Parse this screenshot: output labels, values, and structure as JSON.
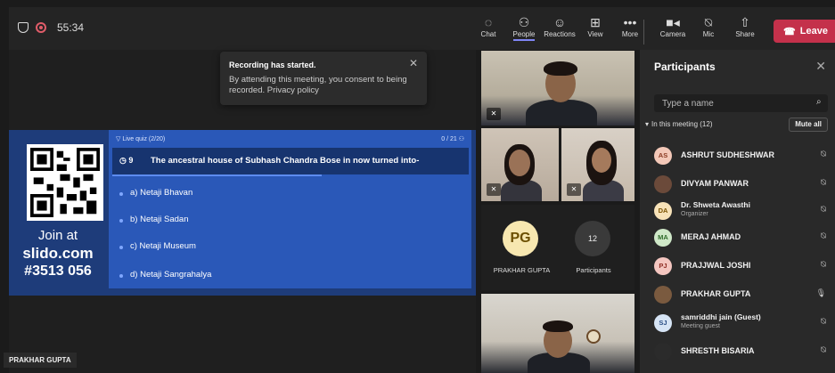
{
  "topbar": {
    "timer": "55:34",
    "tools": [
      {
        "label": "Chat",
        "icon": "chat-icon"
      },
      {
        "label": "People",
        "icon": "people-icon"
      },
      {
        "label": "Reactions",
        "icon": "reactions-icon"
      },
      {
        "label": "View",
        "icon": "view-icon"
      },
      {
        "label": "More",
        "icon": "more-icon"
      },
      {
        "label": "Camera",
        "icon": "camera-icon"
      },
      {
        "label": "Mic",
        "icon": "mic-off-icon"
      },
      {
        "label": "Share",
        "icon": "share-icon"
      }
    ],
    "leave_label": "Leave",
    "leave_color": "#c4314b"
  },
  "toast": {
    "title": "Recording has started.",
    "body": "By attending this meeting, you consent to being recorded. Privacy policy"
  },
  "slido": {
    "join_text": "Join at",
    "url": "slido.com",
    "code": "#3513 056",
    "quiz_label": "Live quiz (2/20)",
    "response_count": "0 / 21",
    "timer": "9",
    "question": "The ancestral house of Subhash Chandra Bose in now turned into-",
    "options": [
      "a) Netaji Bhavan",
      "b) Netaji Sadan",
      "c) Netaji Museum",
      "d) Netaji Sangrahalya"
    ]
  },
  "stage_name_label": "PRAKHAR GUPTA",
  "tiles": {
    "pg_initials": "PG",
    "pg_name": "PRAKHAR GUPTA",
    "count": "12",
    "count_label": "Participants"
  },
  "participants": {
    "title": "Participants",
    "search_placeholder": "Type a name",
    "in_meeting": "In this meeting (12)",
    "mute_all": "Mute all",
    "list": [
      {
        "initials": "AS",
        "name": "ASHRUT SUDHESHWAR",
        "role": "",
        "avatar_bg": "#f3c8b8",
        "avatar_fg": "#8a3a22",
        "photo": false,
        "mic": "muted"
      },
      {
        "initials": "",
        "name": "DIVYAM PANWAR",
        "role": "",
        "avatar_bg": "#6b4a3a",
        "avatar_fg": "#fff",
        "photo": true,
        "mic": "muted"
      },
      {
        "initials": "DA",
        "name": "Dr. Shweta Awasthi",
        "role": "Organizer",
        "avatar_bg": "#f7e2b8",
        "avatar_fg": "#7a5200",
        "photo": false,
        "mic": "muted"
      },
      {
        "initials": "MA",
        "name": "MERAJ AHMAD",
        "role": "",
        "avatar_bg": "#cfe8c8",
        "avatar_fg": "#2e6b2a",
        "photo": false,
        "mic": "muted"
      },
      {
        "initials": "PJ",
        "name": "PRAJJWAL JOSHI",
        "role": "",
        "avatar_bg": "#f4c6c0",
        "avatar_fg": "#8f2e24",
        "photo": false,
        "mic": "muted"
      },
      {
        "initials": "",
        "name": "PRAKHAR GUPTA",
        "role": "",
        "avatar_bg": "#7a5a3f",
        "avatar_fg": "#fff",
        "photo": true,
        "mic": "on"
      },
      {
        "initials": "SJ",
        "name": "samriddhi jain (Guest)",
        "role": "Meeting guest",
        "avatar_bg": "#d6e4f5",
        "avatar_fg": "#2b4f86",
        "photo": false,
        "mic": "muted"
      },
      {
        "initials": "",
        "name": "SHRESTH BISARIA",
        "role": "",
        "avatar_bg": "#2b2b2b",
        "avatar_fg": "#fff",
        "photo": true,
        "mic": "muted"
      }
    ]
  }
}
